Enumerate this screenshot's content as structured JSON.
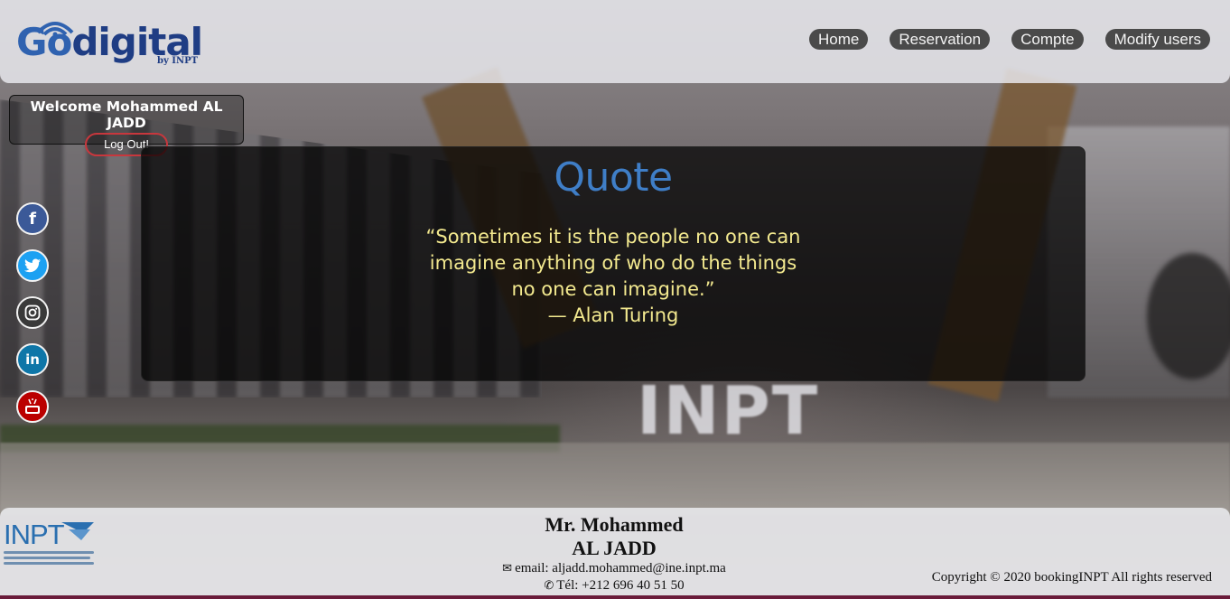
{
  "brand": {
    "logo_main_go": "Go",
    "logo_main_rest": "digital",
    "logo_sub": "by INPT"
  },
  "nav": {
    "items": [
      {
        "label": "Home"
      },
      {
        "label": "Reservation"
      },
      {
        "label": "Compte"
      },
      {
        "label": "Modify users"
      }
    ]
  },
  "welcome": {
    "text": "Welcome Mohammed AL JADD",
    "logout_label": "Log Out!"
  },
  "social": {
    "icons": [
      "facebook-icon",
      "twitter-icon",
      "instagram-icon",
      "linkedin-icon",
      "youtube-icon"
    ],
    "facebook_glyph": "f",
    "linkedin_glyph": "in"
  },
  "background": {
    "sign_word": "INPT"
  },
  "quote": {
    "title": "Quote",
    "line1": "“Sometimes it is the people no one can",
    "line2": "imagine anything of who do the things",
    "line3": "no one can imagine.”",
    "author": "— Alan Turing",
    "title_color": "#3f7ec7",
    "text_color": "#f3e98f"
  },
  "footer": {
    "logo_word": "INPT",
    "name_line1": "Mr. Mohammed",
    "name_line2": "AL JADD",
    "email": "email: aljadd.mohammed@ine.inpt.ma",
    "phone": "Tél: +212 696 40 51 50",
    "copyright": "Copyright © 2020 bookingINPT All rights reserved"
  },
  "colors": {
    "nav_bg": "#4a4a4a",
    "logout_border": "#c8373d",
    "brand_blue": "#1f3d84"
  }
}
